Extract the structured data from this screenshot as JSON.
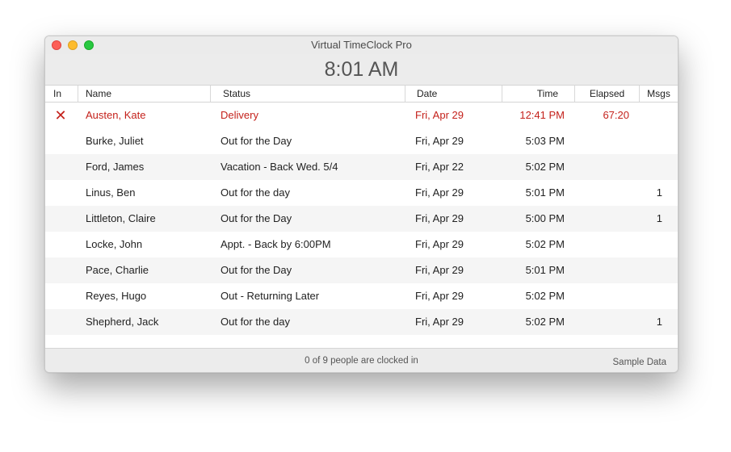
{
  "window": {
    "title": "Virtual TimeClock Pro"
  },
  "clock": {
    "time": "8:01 AM"
  },
  "columns": [
    "In",
    "Name",
    "Status",
    "Date",
    "Time",
    "Elapsed",
    "Msgs"
  ],
  "rows": [
    {
      "in": "✕",
      "name": "Austen, Kate",
      "status": "Delivery",
      "date": "Fri, Apr 29",
      "time": "12:41 PM",
      "elapsed": "67:20",
      "msgs": ""
    },
    {
      "in": "",
      "name": "Burke, Juliet",
      "status": "Out for the Day",
      "date": "Fri, Apr 29",
      "time": "5:03 PM",
      "elapsed": "",
      "msgs": ""
    },
    {
      "in": "",
      "name": "Ford, James",
      "status": "Vacation - Back Wed. 5/4",
      "date": "Fri, Apr 22",
      "time": "5:02 PM",
      "elapsed": "",
      "msgs": ""
    },
    {
      "in": "",
      "name": "Linus, Ben",
      "status": "Out for the day",
      "date": "Fri, Apr 29",
      "time": "5:01 PM",
      "elapsed": "",
      "msgs": "1"
    },
    {
      "in": "",
      "name": "Littleton, Claire",
      "status": "Out for the Day",
      "date": "Fri, Apr 29",
      "time": "5:00 PM",
      "elapsed": "",
      "msgs": "1"
    },
    {
      "in": "",
      "name": "Locke, John",
      "status": "Appt. - Back by 6:00PM",
      "date": "Fri, Apr 29",
      "time": "5:02 PM",
      "elapsed": "",
      "msgs": ""
    },
    {
      "in": "",
      "name": "Pace, Charlie",
      "status": "Out for the Day",
      "date": "Fri, Apr 29",
      "time": "5:01 PM",
      "elapsed": "",
      "msgs": ""
    },
    {
      "in": "",
      "name": "Reyes, Hugo",
      "status": "Out - Returning Later",
      "date": "Fri, Apr 29",
      "time": "5:02 PM",
      "elapsed": "",
      "msgs": ""
    },
    {
      "in": "",
      "name": "Shepherd, Jack",
      "status": "Out for the day",
      "date": "Fri, Apr 29",
      "time": "5:02 PM",
      "elapsed": "",
      "msgs": "1"
    }
  ],
  "footer": {
    "status": "0 of 9 people are clocked in",
    "source": "Sample Data"
  },
  "colors": {
    "alert": "#c4211b"
  }
}
